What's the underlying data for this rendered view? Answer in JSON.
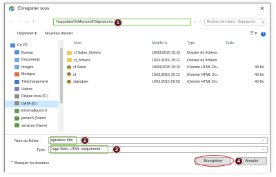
{
  "window": {
    "title": "Enregistrer sous",
    "close_glyph": "✕"
  },
  "address": {
    "back": "←",
    "forward": "→",
    "up": "↑",
    "down": "⌄",
    "path": "%appdata%\\Microsoft\\Signatures",
    "dropdown": "⌄",
    "go": "→",
    "search_placeholder": "Rechercher dans : Signatures",
    "search_glyph": "⌕"
  },
  "toolbar": {
    "organize": "Organiser ▾",
    "new_folder": "Nouveau dossier",
    "view_glyph": "☰ ▾",
    "help": "?"
  },
  "sidebar": [
    {
      "label": "Ce PC",
      "color": "#4a8fd8",
      "selected": false
    },
    {
      "label": "Bureau",
      "color": "#4a8fd8",
      "selected": false
    },
    {
      "label": "Documents",
      "color": "#7aa6d6",
      "selected": false
    },
    {
      "label": "Images",
      "color": "#7aa6d6",
      "selected": false
    },
    {
      "label": "Musique",
      "color": "#e06d3b",
      "selected": false
    },
    {
      "label": "Téléchargement",
      "color": "#3a78c4",
      "selected": false
    },
    {
      "label": "Vidéos",
      "color": "#8a7bd0",
      "selected": false
    },
    {
      "label": "Disque local (C:)",
      "color": "#8c8c8c",
      "selected": false
    },
    {
      "label": "DATA (D:)",
      "color": "#8c8c8c",
      "selected": true
    },
    {
      "label": "informatiqueS (\\",
      "color": "#5e9c4a",
      "selected": false
    },
    {
      "label": "jamanS (\\\\servi",
      "color": "#5e9c4a",
      "selected": false
    },
    {
      "label": "services (\\\\servi",
      "color": "#5e9c4a",
      "selected": false
    }
  ],
  "columns": {
    "name": "Nom",
    "modified": "Modifié le",
    "type": "Type",
    "size": "Taille"
  },
  "files": [
    {
      "name": "cf Salon_fichiers",
      "modified": "18/03/2015 15:15",
      "type": "Dossier de fichiers",
      "size": "",
      "kind": "folder"
    },
    {
      "name": "cf_fichiers",
      "modified": "10/11/2015 15:12",
      "type": "Dossier de fichiers",
      "size": "",
      "kind": "folder"
    },
    {
      "name": "cf Salon",
      "modified": "18/03/2015 15:15",
      "type": "Chrome HTML Do...",
      "size": "43 Ko",
      "kind": "chrome"
    },
    {
      "name": "cf",
      "modified": "10/11/2015 15:12",
      "type": "Chrome HTML Do...",
      "size": "43 Ko",
      "kind": "chrome"
    },
    {
      "name": "signature",
      "modified": "19/11/2015 09:50",
      "type": "Chrome HTML Do...",
      "size": "43 Ko",
      "kind": "chrome"
    }
  ],
  "form": {
    "filename_label": "Nom du fichier :",
    "filename_value": "signature.htm",
    "type_label": "Type :",
    "type_value": "Page Web, HTML uniquement",
    "hide_folders": "Masquer les dossiers",
    "save": "Enregistrer",
    "cancel": "Annuler",
    "drop": "⌄"
  },
  "badges": [
    "1",
    "2",
    "3",
    "4"
  ],
  "colors": {
    "highlight_green": "#7cc242",
    "badge": "#5a1618",
    "ring_red": "#d8222a",
    "selection": "#cce8ff"
  }
}
